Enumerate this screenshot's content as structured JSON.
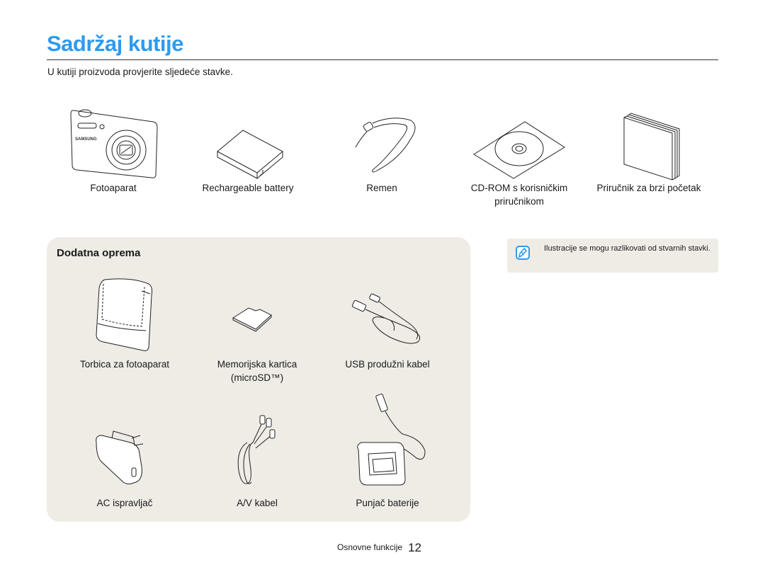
{
  "page": {
    "title": "Sadržaj kutije",
    "intro": "U kutiji proizvoda provjerite sljedeće stavke."
  },
  "box_items": [
    {
      "label": "Fotoaparat",
      "icon": "camera-icon"
    },
    {
      "label": "Rechargeable battery",
      "icon": "battery-icon"
    },
    {
      "label": "Remen",
      "icon": "strap-icon"
    },
    {
      "label": "CD-ROM s korisničkim priručnikom",
      "icon": "cd-rom-icon"
    },
    {
      "label": "Priručnik za brzi početak",
      "icon": "manual-icon"
    }
  ],
  "accessories": {
    "title": "Dodatna oprema",
    "items": [
      {
        "label": "Torbica za fotoaparat",
        "icon": "camera-case-icon"
      },
      {
        "label": "Memorijska kartica (microSD™)",
        "icon": "microsd-card-icon"
      },
      {
        "label": "USB produžni kabel",
        "icon": "usb-cable-icon"
      },
      {
        "label": "AC ispravljač",
        "icon": "ac-adapter-icon"
      },
      {
        "label": "A/V kabel",
        "icon": "av-cable-icon"
      },
      {
        "label": "Punjač baterije",
        "icon": "battery-charger-icon"
      }
    ]
  },
  "note": {
    "icon": "note-pencil-icon",
    "text": "Ilustracije se mogu razlikovati od stvarnih stavki.",
    "icon_color": "#2d9bf0"
  },
  "footer": {
    "section": "Osnovne funkcije",
    "page_number": "12"
  },
  "colors": {
    "title": "#2d9bf0",
    "panel_bg": "#efece6"
  }
}
